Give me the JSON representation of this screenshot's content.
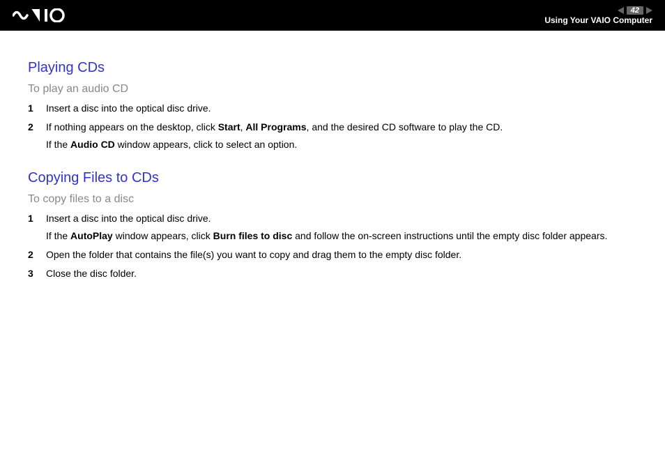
{
  "header": {
    "page_number": "42",
    "section_title": "Using Your VAIO Computer",
    "logo_alt": "VAIO"
  },
  "sections": [
    {
      "heading": "Playing CDs",
      "sub_heading": "To play an audio CD",
      "steps": [
        {
          "num": "1",
          "text_parts": [
            {
              "t": "Insert a disc into the optical disc drive.",
              "b": false
            }
          ]
        },
        {
          "num": "2",
          "text_parts": [
            {
              "t": "If nothing appears on the desktop, click ",
              "b": false
            },
            {
              "t": "Start",
              "b": true
            },
            {
              "t": ", ",
              "b": false
            },
            {
              "t": "All Programs",
              "b": true
            },
            {
              "t": ", and the desired CD software to play the CD.",
              "b": false
            }
          ],
          "sub_parts": [
            {
              "t": "If the ",
              "b": false
            },
            {
              "t": "Audio CD",
              "b": true
            },
            {
              "t": " window appears, click to select an option.",
              "b": false
            }
          ]
        }
      ]
    },
    {
      "heading": "Copying Files to CDs",
      "sub_heading": "To copy files to a disc",
      "steps": [
        {
          "num": "1",
          "text_parts": [
            {
              "t": "Insert a disc into the optical disc drive.",
              "b": false
            }
          ],
          "sub_parts": [
            {
              "t": "If the ",
              "b": false
            },
            {
              "t": "AutoPlay",
              "b": true
            },
            {
              "t": " window appears, click ",
              "b": false
            },
            {
              "t": "Burn files to disc",
              "b": true
            },
            {
              "t": " and follow the on-screen instructions until the empty disc folder appears.",
              "b": false
            }
          ]
        },
        {
          "num": "2",
          "text_parts": [
            {
              "t": "Open the folder that contains the file(s) you want to copy and drag them to the empty disc folder.",
              "b": false
            }
          ]
        },
        {
          "num": "3",
          "text_parts": [
            {
              "t": "Close the disc folder.",
              "b": false
            }
          ]
        }
      ]
    }
  ]
}
